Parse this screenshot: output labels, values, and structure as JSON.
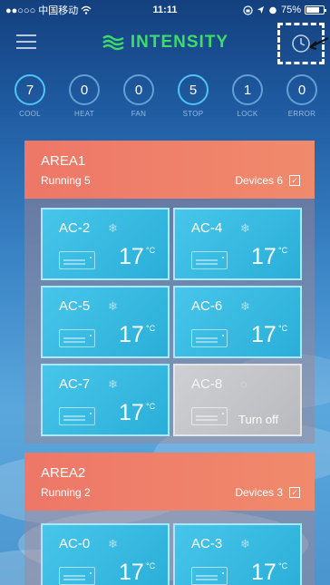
{
  "status_bar": {
    "carrier": "●●○○○ 中国移动",
    "time": "11:11",
    "battery": "75%"
  },
  "header": {
    "logo_text": "INTENSITY",
    "trademark": "."
  },
  "stats": [
    {
      "value": "7",
      "label": "COOL",
      "active": true
    },
    {
      "value": "0",
      "label": "HEAT",
      "active": false
    },
    {
      "value": "0",
      "label": "FAN",
      "active": false
    },
    {
      "value": "5",
      "label": "STOP",
      "active": true
    },
    {
      "value": "1",
      "label": "LOCK",
      "active": false
    },
    {
      "value": "0",
      "label": "ERROR",
      "active": false
    }
  ],
  "areas": [
    {
      "title": "AREA1",
      "running": "Running 5",
      "devices": "Devices 6",
      "units": [
        {
          "name": "AC-2",
          "temp": "17",
          "unit": "°C",
          "off_label": ""
        },
        {
          "name": "AC-4",
          "temp": "17",
          "unit": "°C",
          "off_label": ""
        },
        {
          "name": "AC-5",
          "temp": "17",
          "unit": "°C",
          "off_label": ""
        },
        {
          "name": "AC-6",
          "temp": "17",
          "unit": "°C",
          "off_label": ""
        },
        {
          "name": "AC-7",
          "temp": "17",
          "unit": "°C",
          "off_label": ""
        },
        {
          "name": "AC-8",
          "temp": "",
          "unit": "",
          "off_label": "Turn off"
        }
      ]
    },
    {
      "title": "AREA2",
      "running": "Running 2",
      "devices": "Devices 3",
      "units": [
        {
          "name": "AC-0",
          "temp": "17",
          "unit": "°C",
          "off_label": ""
        },
        {
          "name": "AC-3",
          "temp": "17",
          "unit": "°C",
          "off_label": ""
        }
      ]
    }
  ],
  "colors": {
    "accent_green": "#3ddc6a",
    "area_header": "#ee7768",
    "card_on": "#2aaed8",
    "card_off": "#c4c5c8"
  },
  "icons": {
    "menu": "menu-icon",
    "logo": "wave-logo-icon",
    "timer": "clock-icon",
    "mode_cool": "snowflake-icon",
    "mode_off": "power-ring-icon"
  }
}
